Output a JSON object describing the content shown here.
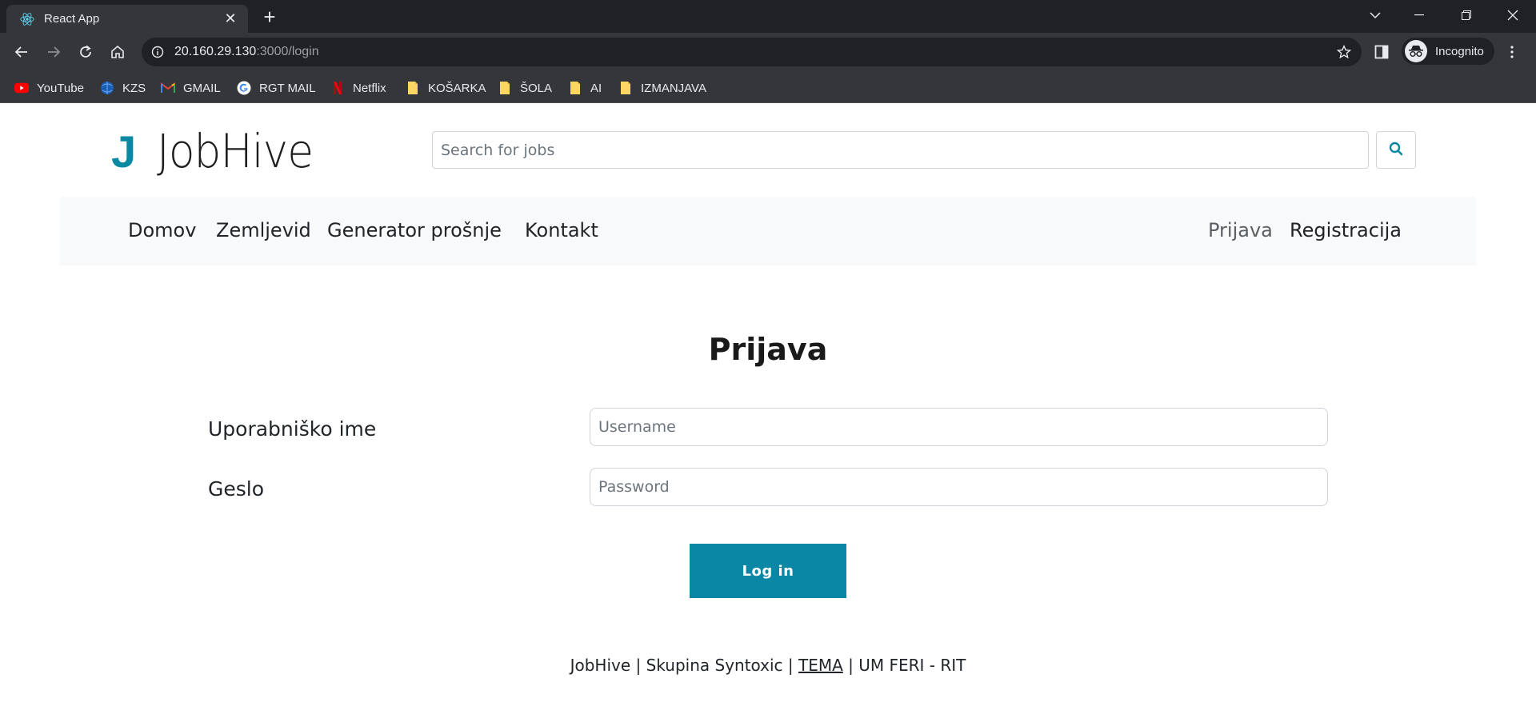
{
  "browser": {
    "tab_title": "React App",
    "url_host": "20.160.29.130",
    "url_path": ":3000/login",
    "profile_label": "Incognito",
    "bookmarks": [
      {
        "label": "YouTube",
        "icon": "youtube-icon"
      },
      {
        "label": "KZS",
        "icon": "kzs-icon"
      },
      {
        "label": "GMAIL",
        "icon": "gmail-icon"
      },
      {
        "label": "RGT MAIL",
        "icon": "google-icon"
      },
      {
        "label": "Netflix",
        "icon": "netflix-icon"
      },
      {
        "label": "KOŠARKA",
        "icon": "folder-icon"
      },
      {
        "label": "ŠOLA",
        "icon": "folder-icon"
      },
      {
        "label": "AI",
        "icon": "folder-icon"
      },
      {
        "label": "IZMANJAVA",
        "icon": "folder-icon"
      }
    ]
  },
  "header": {
    "logo_mark": "J",
    "logo_text": "JobHive",
    "search_placeholder": "Search for jobs"
  },
  "nav": {
    "left": [
      "Domov",
      "Zemljevid",
      "Generator prošnje",
      "Kontakt"
    ],
    "right": [
      "Prijava",
      "Registracija"
    ],
    "active": "Prijava"
  },
  "login": {
    "title": "Prijava",
    "username_label": "Uporabniško ime",
    "username_placeholder": "Username",
    "password_label": "Geslo",
    "password_placeholder": "Password",
    "submit_label": "Log in"
  },
  "footer": {
    "prefix": "JobHive | Skupina Syntoxic | ",
    "link": "TEMA",
    "suffix": " | UM FERI - RIT"
  },
  "colors": {
    "accent": "#0a87a5",
    "navbar_bg": "#f8f9fa",
    "chrome_dark": "#202124",
    "chrome_toolbar": "#35363a"
  }
}
